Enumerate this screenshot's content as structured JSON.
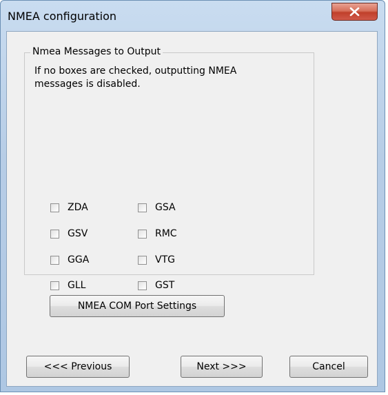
{
  "window": {
    "title": "NMEA configuration"
  },
  "group": {
    "legend": "Nmea Messages to Output",
    "description": "If no boxes are checked, outputting NMEA messages is disabled."
  },
  "checkboxes": [
    {
      "label": "ZDA",
      "checked": false
    },
    {
      "label": "GSV",
      "checked": false
    },
    {
      "label": "GGA",
      "checked": false
    },
    {
      "label": "GLL",
      "checked": false
    },
    {
      "label": "GSA",
      "checked": false
    },
    {
      "label": "RMC",
      "checked": false
    },
    {
      "label": "VTG",
      "checked": false
    },
    {
      "label": "GST",
      "checked": false
    }
  ],
  "buttons": {
    "com_port": "NMEA COM Port Settings",
    "previous": "<<< Previous",
    "next": "Next >>>",
    "cancel": "Cancel"
  },
  "icons": {
    "close": "close-x-icon"
  },
  "colors": {
    "title_bar": "#b7cde6",
    "client_bg": "#f0f0f0",
    "close_button": "#c0402a"
  }
}
